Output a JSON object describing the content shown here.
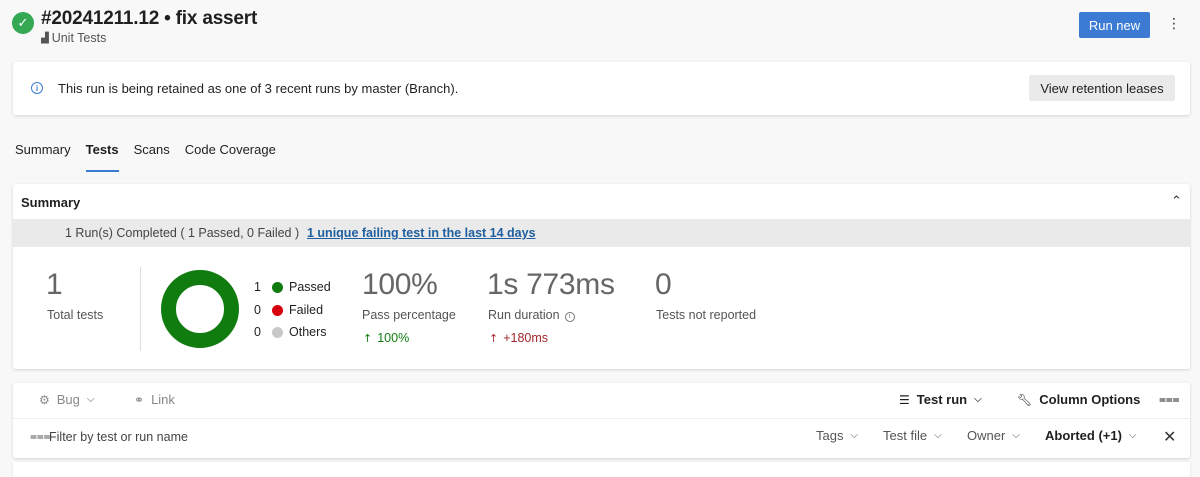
{
  "header": {
    "run_title": "#20241211.12 • fix assert",
    "pipeline_name": "Unit Tests",
    "run_new_label": "Run new",
    "more_icon": "more-vertical-icon"
  },
  "banner": {
    "message": "This run is being retained as one of 3 recent runs by master (Branch).",
    "button_label": "View retention leases"
  },
  "tabs": [
    {
      "label": "Summary",
      "active": false
    },
    {
      "label": "Tests",
      "active": true
    },
    {
      "label": "Scans",
      "active": false
    },
    {
      "label": "Code Coverage",
      "active": false
    }
  ],
  "summary": {
    "title": "Summary",
    "runs_text": "1 Run(s) Completed ( 1 Passed, 0 Failed )",
    "failing_link": "1 unique failing test in the last 14 days",
    "total_tests": {
      "value": "1",
      "label": "Total tests"
    },
    "legend": [
      {
        "count": "1",
        "label": "Passed",
        "color": "#107c10"
      },
      {
        "count": "0",
        "label": "Failed",
        "color": "#d9000d"
      },
      {
        "count": "0",
        "label": "Others",
        "color": "#c8c8c8"
      }
    ],
    "pass_percentage": {
      "value": "100%",
      "label": "Pass percentage",
      "delta": "100%",
      "delta_color": "#107c10"
    },
    "run_duration": {
      "value": "1s 773ms",
      "label": "Run duration",
      "delta": "+180ms",
      "delta_color": "#a4262c"
    },
    "not_reported": {
      "value": "0",
      "label": "Tests not reported"
    }
  },
  "toolbar": {
    "bug_label": "Bug",
    "link_label": "Link",
    "test_run_label": "Test run",
    "column_options_label": "Column Options",
    "filter_placeholder": "Filter by test or run name",
    "filters": {
      "tags": "Tags",
      "test_file": "Test file",
      "owner": "Owner",
      "outcome": "Aborted (+1)"
    }
  }
}
